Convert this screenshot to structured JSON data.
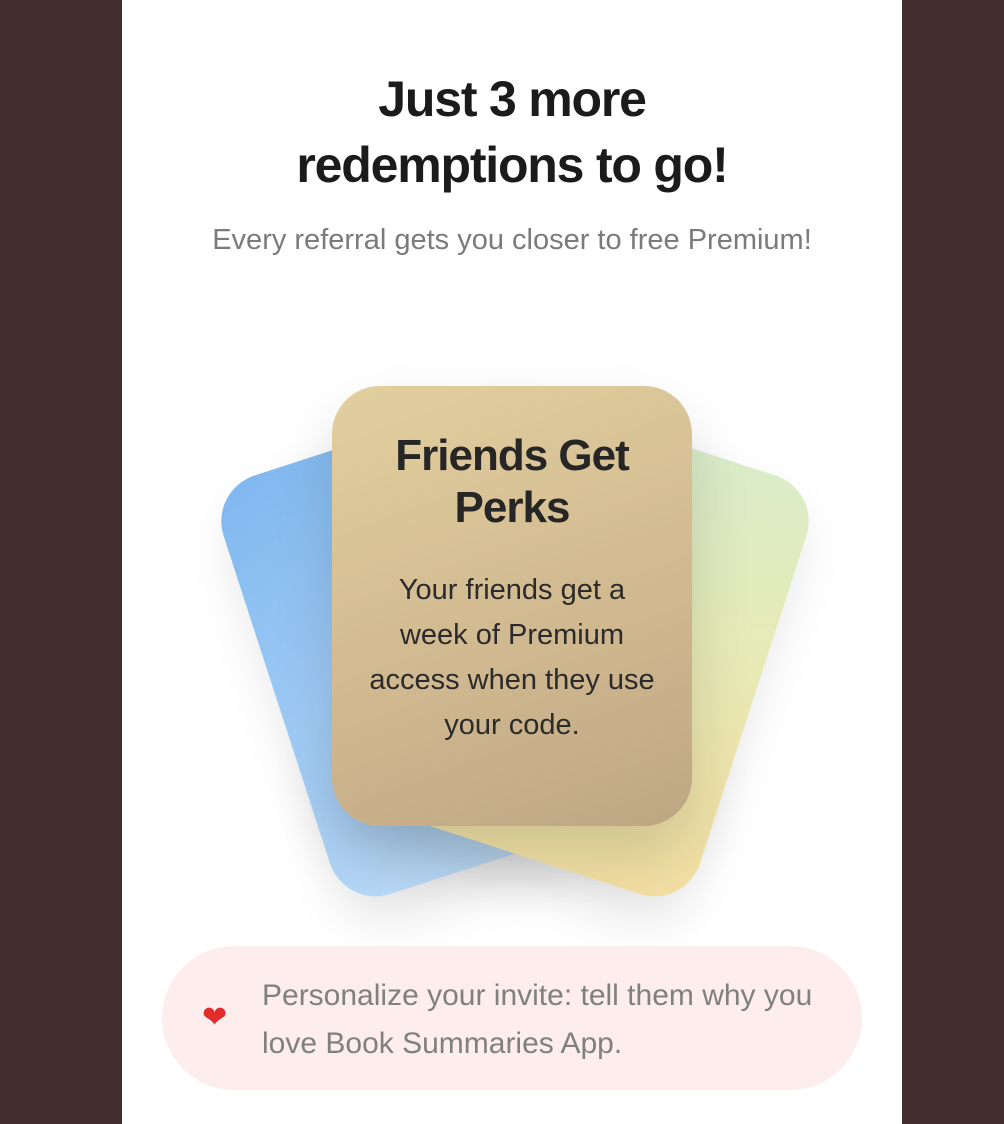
{
  "header": {
    "title_line1": "Just 3 more",
    "title_line2": "redemptions to go!",
    "subtitle": "Every referral gets you closer to free Premium!"
  },
  "cards": {
    "center": {
      "title_line1": "Friends Get",
      "title_line2": "Perks",
      "body": "Your friends get a week of Premium access when they use your code."
    },
    "left": {
      "title": "",
      "body": ""
    },
    "right": {
      "title": "",
      "body": ""
    }
  },
  "tip": {
    "icon": "heart-icon",
    "icon_glyph": "❤",
    "text": "Personalize your invite: tell them why you love Book Summaries App."
  },
  "colors": {
    "background_outer": "#432d2d",
    "page": "#ffffff",
    "card_left": "#7fb7ef",
    "card_center": "#d6c194",
    "card_right": "#e6ebb7",
    "tip_background": "#fdeded"
  }
}
